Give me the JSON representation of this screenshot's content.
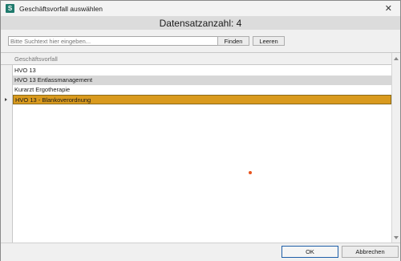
{
  "window": {
    "app_icon_letter": "S",
    "title": "Geschäftsvorfall auswählen",
    "close_glyph": "✕"
  },
  "header": {
    "record_count_label": "Datensatzanzahl: 4"
  },
  "search": {
    "placeholder": "Bitte Suchtext hier eingeben...",
    "value": "",
    "find_label": "Finden",
    "clear_label": "Leeren"
  },
  "grid": {
    "column_header": "Geschäftsvorfall",
    "rows": [
      {
        "label": "HVO 13",
        "state": "normal"
      },
      {
        "label": "HVO 13 Entlassmanagement",
        "state": "hover"
      },
      {
        "label": "Kurarzt Ergotherapie",
        "state": "normal"
      },
      {
        "label": "HVO 13 - Blankoverordnung",
        "state": "selected"
      }
    ]
  },
  "footer": {
    "ok_label": "OK",
    "cancel_label": "Abbrechen"
  },
  "colors": {
    "selected_row": "#d99a1e",
    "hover_row": "#d7d7d7",
    "header_bg": "#dcdcdc",
    "app_icon": "#1f7a6d",
    "cursor_dot": "#e8541e"
  },
  "icons": {
    "app": "app-logo-icon",
    "close": "close-icon",
    "row_indicator": "current-row-arrow-icon",
    "scroll_up": "scroll-up-arrow-icon",
    "scroll_down": "scroll-down-arrow-icon"
  }
}
